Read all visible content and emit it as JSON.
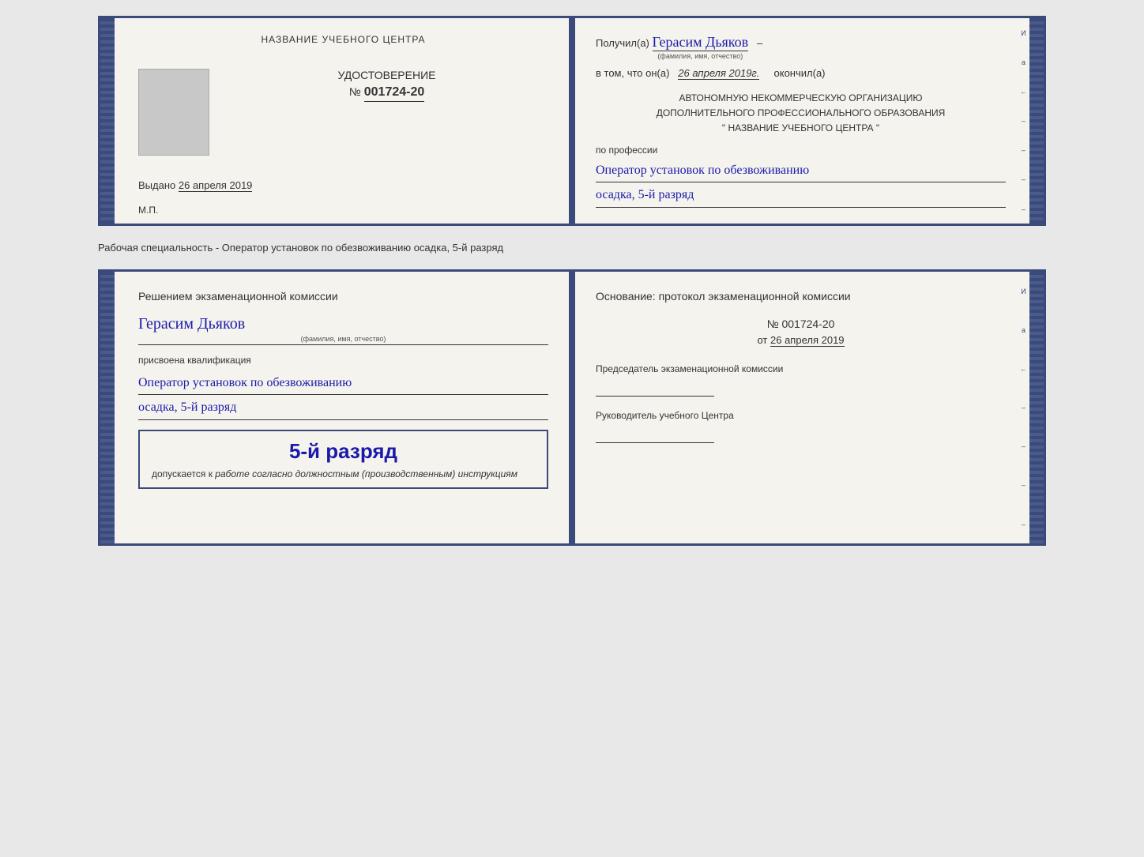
{
  "page": {
    "background": "#e8e8e8"
  },
  "top_cert": {
    "left": {
      "title": "НАЗВАНИЕ УЧЕБНОГО ЦЕНТРА",
      "cert_label": "УДОСТОВЕРЕНИЕ",
      "cert_number_prefix": "№",
      "cert_number": "001724-20",
      "issued_label": "Выдано",
      "issued_date": "26 апреля 2019",
      "mp_label": "М.П."
    },
    "right": {
      "recipient_prefix": "Получил(а)",
      "recipient_name": "Герасим Дьяков",
      "name_subtitle": "(фамилия, имя, отчество)",
      "dash": "–",
      "date_prefix": "в том, что он(а)",
      "date_value": "26 апреля 2019г.",
      "date_suffix": "окончил(а)",
      "org_line1": "АВТОНОМНУЮ НЕКОММЕРЧЕСКУЮ ОРГАНИЗАЦИЮ",
      "org_line2": "ДОПОЛНИТЕЛЬНОГО ПРОФЕССИОНАЛЬНОГО ОБРАЗОВАНИЯ",
      "org_line3": "\"   НАЗВАНИЕ УЧЕБНОГО ЦЕНТРА   \"",
      "profession_label": "по профессии",
      "profession_value": "Оператор установок по обезвоживанию",
      "profession_sub": "осадка, 5-й разряд"
    }
  },
  "separator": {
    "text": "Рабочая специальность - Оператор установок по обезвоживанию осадка, 5-й разряд"
  },
  "bottom_cert": {
    "left": {
      "commission_title": "Решением экзаменационной комиссии",
      "name": "Герасим Дьяков",
      "name_subtitle": "(фамилия, имя, отчество)",
      "qualification_prefix": "присвоена квалификация",
      "qualification_value": "Оператор установок по обезвоживанию",
      "qualification_sub": "осадка, 5-й разряд",
      "stamp_rank": "5-й разряд",
      "stamp_permission": "допускается к",
      "stamp_permission_italic": "работе согласно должностным (производственным) инструкциям"
    },
    "right": {
      "basis_title": "Основание: протокол экзаменационной комиссии",
      "basis_number": "№  001724-20",
      "basis_date_prefix": "от",
      "basis_date": "26 апреля 2019",
      "chairman_title": "Председатель экзаменационной комиссии",
      "director_title": "Руководитель учебного Центра"
    }
  },
  "side_chars": [
    "И",
    "а",
    "←",
    "–",
    "–",
    "–",
    "–"
  ],
  "side_chars2": [
    "И",
    "а",
    "←",
    "–",
    "–",
    "–",
    "–"
  ]
}
